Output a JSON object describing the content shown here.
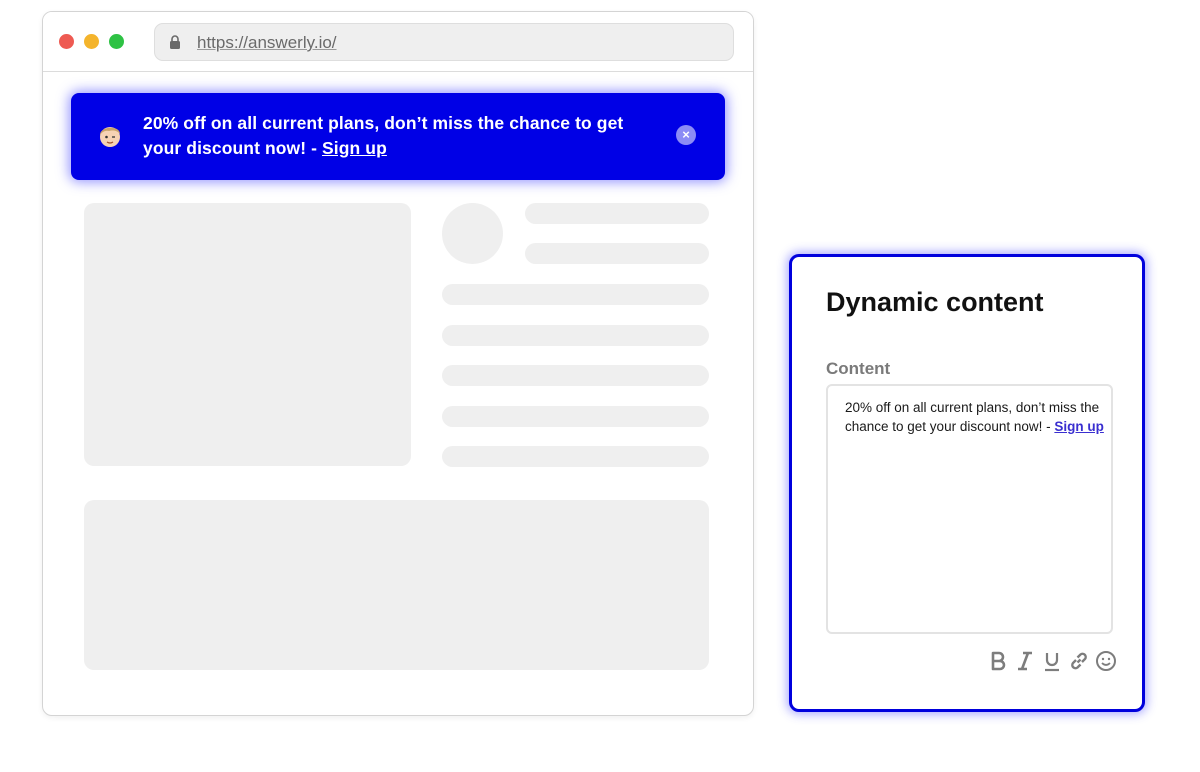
{
  "browser": {
    "url": "https://answerly.io/"
  },
  "banner": {
    "message": "20% off on all current plans, don’t miss the chance to get your discount now! - ",
    "link_label": "Sign up",
    "close_symbol": "×",
    "background_color": "#0000e6"
  },
  "panel": {
    "title": "Dynamic content",
    "content_label": "Content",
    "editor_text": "20% off on all current plans, don’t miss the chance to get your discount now! - ",
    "editor_link": "Sign up",
    "border_color": "#0000dd",
    "toolbar": [
      "bold-icon",
      "italic-icon",
      "underline-icon",
      "link-icon",
      "emoji-icon"
    ]
  }
}
